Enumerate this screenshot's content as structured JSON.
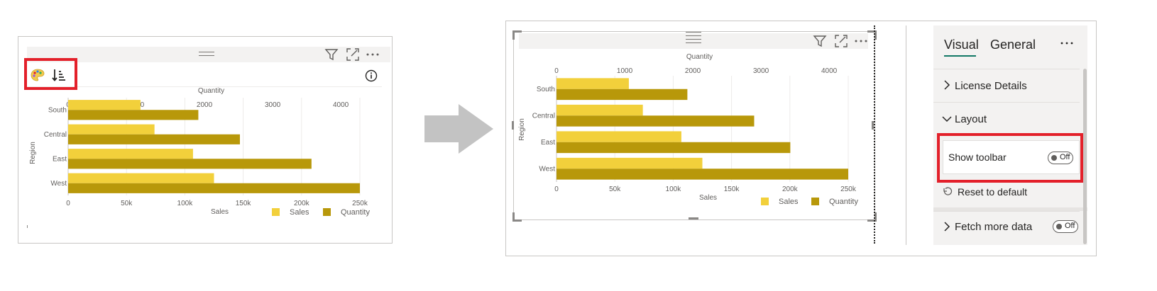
{
  "left_visual": {
    "toolbar_icons": [
      "palette-icon",
      "sort-icon"
    ],
    "info_icon": "info-icon"
  },
  "right_visual": {},
  "header_icons": [
    "filter-icon",
    "focus-mode-icon",
    "more-options-icon"
  ],
  "arrow_icon": "right-arrow-icon",
  "chart_data": [
    {
      "type": "bar",
      "orientation": "horizontal",
      "categories": [
        "South",
        "Central",
        "East",
        "West"
      ],
      "series": [
        {
          "name": "Sales",
          "axis": "bottom",
          "color": "#f2d03b",
          "values": [
            62000,
            74000,
            107000,
            125000
          ]
        },
        {
          "name": "Quantity",
          "axis": "top",
          "color": "#b8980a",
          "values": [
            1910,
            2520,
            3570,
            4280
          ]
        }
      ],
      "ylabel": "Region",
      "xlabel_bottom": "Sales",
      "xlabel_top": "Quantity",
      "x_bottom_ticks": [
        "0",
        "50k",
        "100k",
        "150k",
        "200k",
        "250k"
      ],
      "x_bottom_range": [
        0,
        250000
      ],
      "x_top_ticks": [
        "0",
        "1000",
        "2000",
        "3000",
        "4000"
      ],
      "x_top_range": [
        0,
        4280
      ],
      "grid": true,
      "legend": {
        "placement": "bottom-right",
        "items": [
          "Sales",
          "Quantity"
        ]
      }
    },
    {
      "type": "bar",
      "orientation": "horizontal",
      "categories": [
        "South",
        "Central",
        "East",
        "West"
      ],
      "series": [
        {
          "name": "Sales",
          "axis": "bottom",
          "color": "#f2d03b",
          "values": [
            62000,
            74000,
            107000,
            125000
          ]
        },
        {
          "name": "Quantity",
          "axis": "top",
          "color": "#b8980a",
          "values": [
            1920,
            2900,
            3430,
            4280
          ]
        }
      ],
      "ylabel": "Region",
      "xlabel_bottom": "Sales",
      "xlabel_top": "Quantity",
      "x_bottom_ticks": [
        "0",
        "50k",
        "100k",
        "150k",
        "200k",
        "250k"
      ],
      "x_bottom_range": [
        0,
        250000
      ],
      "x_top_ticks": [
        "0",
        "1000",
        "2000",
        "3000",
        "4000"
      ],
      "x_top_range": [
        0,
        4280
      ],
      "grid": true,
      "legend": {
        "placement": "bottom-right",
        "items": [
          "Sales",
          "Quantity"
        ]
      }
    }
  ],
  "format_pane": {
    "tabs": [
      "Visual",
      "General"
    ],
    "active_tab": "Visual",
    "more_icon": "more-options-icon",
    "sections": {
      "license": "License Details",
      "layout": "Layout",
      "show_toolbar": "Show toolbar",
      "show_toolbar_state": "Off",
      "reset": "Reset to default",
      "fetch": "Fetch more data",
      "fetch_state": "Off"
    }
  },
  "colors": {
    "highlight": "#e3202a",
    "accent": "#117865",
    "sales": "#f2d03b",
    "quantity": "#b8980a"
  }
}
